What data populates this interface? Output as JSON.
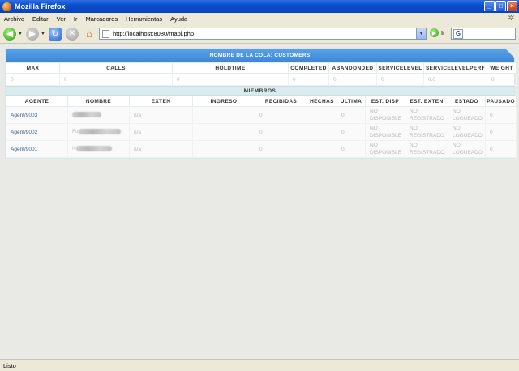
{
  "window": {
    "title": "Mozilla Firefox",
    "buttons": {
      "minimize": "_",
      "maximize": "□",
      "close": "×"
    }
  },
  "menu": [
    "Archivo",
    "Editar",
    "Ver",
    "Ir",
    "Marcadores",
    "Herramientas",
    "Ayuda"
  ],
  "navbar": {
    "url": "http://localhost:8080/mapi.php",
    "go_label": "Ir"
  },
  "queue": {
    "title": "NOMBRE DE LA COLA: CUSTOMERS",
    "stat_headers": [
      "MAX",
      "CALLS",
      "HOLDTIME",
      "COMPLETED",
      "ABANDONDED",
      "SERVICELEVEL",
      "SERVICELEVELPERF",
      "WEIGHT"
    ],
    "stat_values": [
      "0",
      "0",
      "0",
      "0",
      "0",
      "0",
      "0.0",
      "0"
    ]
  },
  "members": {
    "title": "MIEMBROS",
    "headers": [
      "AGENTE",
      "NOMBRE",
      "EXTEN",
      "INGRESO",
      "RECIBIDAS",
      "HECHAS",
      "ULTIMA",
      "EST. DISP",
      "EST. EXTEN",
      "ESTADO",
      "PAUSADO"
    ],
    "rows": [
      {
        "agent": "Agent/9003",
        "name_prefix": "",
        "exten": "n/a",
        "ingreso": "",
        "recibidas": "0",
        "hechas": "",
        "ultima": "0",
        "est_disp": [
          "NO",
          "DISPONIBLE"
        ],
        "est_exten": [
          "NO",
          "REGISTRADO"
        ],
        "estado": [
          "NO",
          "LOGUEADO"
        ],
        "pausado": "0"
      },
      {
        "agent": "Agent/9002",
        "name_prefix": "Fu",
        "exten": "n/a",
        "ingreso": "",
        "recibidas": "0",
        "hechas": "",
        "ultima": "0",
        "est_disp": [
          "NO",
          "DISPONIBLE"
        ],
        "est_exten": [
          "NO",
          "REGISTRADO"
        ],
        "estado": [
          "NO",
          "LOGUEADO"
        ],
        "pausado": "0"
      },
      {
        "agent": "Agent/9001",
        "name_prefix": "N",
        "exten": "n/a",
        "ingreso": "",
        "recibidas": "0",
        "hechas": "",
        "ultima": "0",
        "est_disp": [
          "NO",
          "DISPONIBLE"
        ],
        "est_exten": [
          "NO",
          "REGISTRADO"
        ],
        "estado": [
          "NO",
          "LOGUEADO"
        ],
        "pausado": "0"
      }
    ]
  },
  "status": {
    "text": "Listo"
  }
}
